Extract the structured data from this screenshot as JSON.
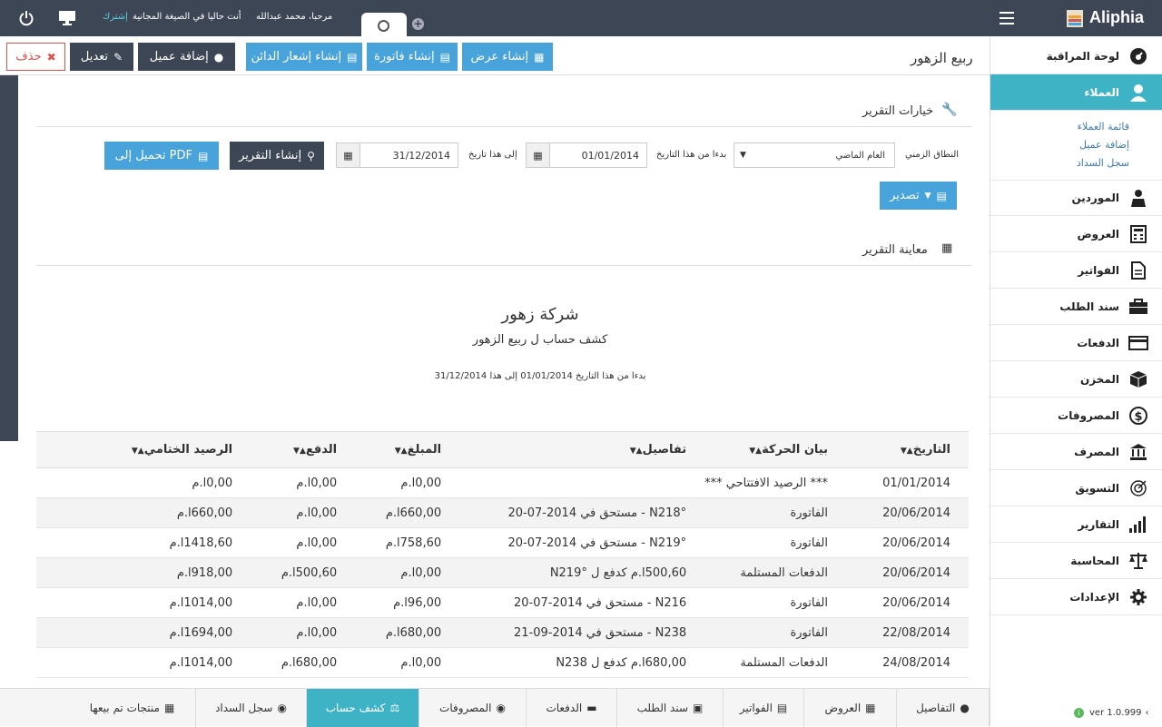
{
  "brand": {
    "name": "Aliphia"
  },
  "topbar": {
    "greeting": "مرحبا، محمد عبدالله",
    "plan_notice": "أنت حاليا في الصيغة المجانية",
    "subscribe_link": "إشترك"
  },
  "sidebar": {
    "items": [
      {
        "label": "لوحة المراقبة",
        "icon": "dashboard-icon"
      },
      {
        "label": "العملاء",
        "icon": "user-icon"
      },
      {
        "label": "الموردين",
        "icon": "supplier-icon"
      },
      {
        "label": "العروض",
        "icon": "calculator-icon"
      },
      {
        "label": "الفواتير",
        "icon": "document-icon"
      },
      {
        "label": "سند الطلب",
        "icon": "briefcase-icon"
      },
      {
        "label": "الدفعات",
        "icon": "card-icon"
      },
      {
        "label": "المخزن",
        "icon": "box-icon"
      },
      {
        "label": "المصروفات",
        "icon": "dollar-icon"
      },
      {
        "label": "المصرف",
        "icon": "bank-icon"
      },
      {
        "label": "التسويق",
        "icon": "target-icon"
      },
      {
        "label": "التقارير",
        "icon": "bars-icon"
      },
      {
        "label": "المحاسبة",
        "icon": "scale-icon"
      },
      {
        "label": "الإعدادات",
        "icon": "gear-icon"
      }
    ],
    "sub_links": [
      "قائمة العملاء",
      "إضافة عميل",
      "سجل السداد"
    ],
    "version": "ver 1.0.999"
  },
  "header": {
    "client_name": "ربيع الزهور",
    "buttons": {
      "quote": "إنشاء عرض",
      "invoice": "إنشاء فاتورة",
      "credit_note": "إنشاء إشعار الدائن",
      "add_client": "إضافة عميل",
      "edit": "تعديل",
      "delete": "حذف"
    }
  },
  "report_options": {
    "section_title": "خيارات التقرير",
    "range_label": "النطاق الزمني",
    "range_value": "العام الماضي",
    "from_label": "بدءا من هذا التاريخ",
    "from_value": "01/01/2014",
    "to_label": "إلى هذا تاريخ",
    "to_value": "31/12/2014",
    "generate_button": "إنشاء التقرير",
    "pdf_button": "تحميل إلى PDF",
    "export_button": "تصدير"
  },
  "preview": {
    "section_title": "معاينة التقرير",
    "company": "شركة زهور",
    "subtitle": "كشف حساب ل ربيع الزهور",
    "range_text": "بدءا من هذا التاريخ 01/01/2014 إلى هذا 31/12/2014"
  },
  "table": {
    "headers": [
      "التاريخ",
      "بيان الحركة",
      "تفاصيل",
      "المبلغ",
      "الدفع",
      "الرصيد الختامي"
    ],
    "rows": [
      [
        "01/01/2014",
        "*** الرصيد الافتتاحي ***",
        "",
        "0,00ا.م",
        "0,00ا.م",
        "0,00ا.م"
      ],
      [
        "20/06/2014",
        "الفاتورة",
        "°N218 - مستحق في 2014-07-20",
        "660,00ا.م",
        "0,00ا.م",
        "660,00ا.م"
      ],
      [
        "20/06/2014",
        "الفاتورة",
        "°N219 - مستحق في 2014-07-20",
        "758,60ا.م",
        "0,00ا.م",
        "1418,60ا.م"
      ],
      [
        "20/06/2014",
        "الدفعات المستلمة",
        "500,60ا.م كدفع ل N219°",
        "0,00ا.م",
        "500,60ا.م",
        "918,00ا.م"
      ],
      [
        "20/06/2014",
        "الفاتورة",
        "N216 - مستحق في 2014-07-20",
        "96,00ا.م",
        "0,00ا.م",
        "1014,00ا.م"
      ],
      [
        "22/08/2014",
        "الفاتورة",
        "N238 - مستحق في 2014-09-21",
        "680,00ا.م",
        "0,00ا.م",
        "1694,00ا.م"
      ],
      [
        "24/08/2014",
        "الدفعات المستلمة",
        "680,00ا.م كدفع ل N238",
        "0,00ا.م",
        "680,00ا.م",
        "1014,00ا.م"
      ]
    ]
  },
  "bottom_tabs": [
    "التفاصيل",
    "العروض",
    "الفواتير",
    "سند الطلب",
    "الدفعات",
    "المصروفات",
    "كشف حساب",
    "سجل السداد",
    "منتجات تم بيعها"
  ],
  "colors": {
    "accent": "#3fb3c6",
    "primary": "#47a3da",
    "dark": "#3d4654",
    "danger": "#d9534f"
  }
}
